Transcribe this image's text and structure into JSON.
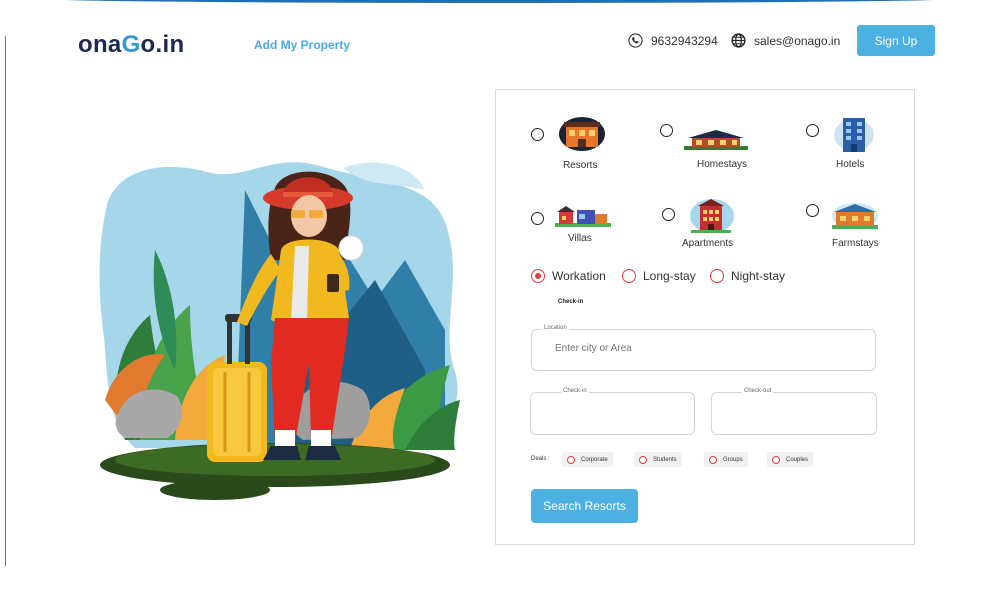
{
  "header": {
    "logo_part1": "ona",
    "logo_part2": "G",
    "logo_part3": "o.in",
    "add_property": "Add My Property",
    "phone": "9632943294",
    "email": "sales@onago.in",
    "signup": "Sign Up"
  },
  "property_types": [
    {
      "label": "Resorts",
      "selected": false,
      "icon": "resort-icon"
    },
    {
      "label": "Homestays",
      "selected": false,
      "icon": "homestay-icon"
    },
    {
      "label": "Hotels",
      "selected": false,
      "icon": "hotel-icon"
    },
    {
      "label": "Villas",
      "selected": false,
      "icon": "villa-icon"
    },
    {
      "label": "Apartments",
      "selected": false,
      "icon": "apartment-icon"
    },
    {
      "label": "Farmstays",
      "selected": false,
      "icon": "farmstay-icon"
    }
  ],
  "stay_types": [
    {
      "label": "Workation",
      "selected": true
    },
    {
      "label": "Long-stay",
      "selected": false
    },
    {
      "label": "Night-stay",
      "selected": false
    }
  ],
  "form": {
    "checkin_caption": "Check-in",
    "location_label": "Location",
    "location_placeholder": "Enter city or Area",
    "checkin_label": "Check-in",
    "checkout_label": "Check-out",
    "deals_label": "Deals :",
    "deals": [
      "Corporate",
      "Students",
      "Groups",
      "Couples"
    ],
    "search_button": "Search Resorts"
  },
  "colors": {
    "brand_dark": "#1d2951",
    "brand_blue": "#4db0e2",
    "radio_red": "#e23b3b"
  }
}
